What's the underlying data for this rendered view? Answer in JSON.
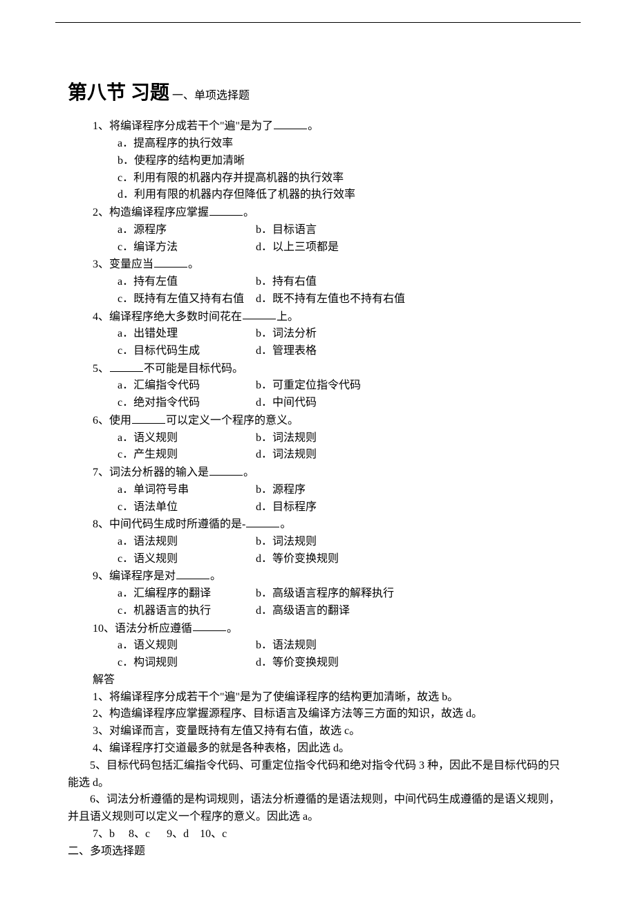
{
  "section_title": "第八节   习题",
  "section_sub": "一、单项选择题",
  "questions": [
    {
      "num": "1",
      "stem_pre": "、将编译程序分成若干个\"遍\"是为了",
      "stem_post": "。",
      "layout": "stack",
      "opts": [
        [
          "a．提高程序的执行效率"
        ],
        [
          "b．使程序的结构更加清晰"
        ],
        [
          "c．利用有限的机器内存并提高机器的执行效率"
        ],
        [
          "d．利用有限的机器内存但降低了机器的执行效率"
        ]
      ]
    },
    {
      "num": "2",
      "stem_pre": "、构造编译程序应掌握",
      "stem_post": "。",
      "layout": "2col",
      "opts": [
        [
          "a．源程序",
          "b．目标语言"
        ],
        [
          "c．编译方法",
          "d．以上三项都是"
        ]
      ]
    },
    {
      "num": "3",
      "stem_pre": "、变量应当",
      "stem_post": "。",
      "layout": "2col",
      "opts": [
        [
          "a．持有左值",
          "b．持有右值"
        ],
        [
          "c．既持有左值又持有右值",
          "d．既不持有左值也不持有右值"
        ]
      ]
    },
    {
      "num": "4",
      "stem_pre": "、编译程序绝大多数时间花在",
      "stem_post": "上。",
      "layout": "2col",
      "opts": [
        [
          "a．出错处理",
          "b．词法分析"
        ],
        [
          "c．目标代码生成",
          "d．管理表格"
        ]
      ]
    },
    {
      "num": "5",
      "stem_pre": "、",
      "stem_post": "不可能是目标代码。",
      "layout": "2col",
      "blank_first": true,
      "opts": [
        [
          "a．汇编指令代码",
          "b．可重定位指令代码"
        ],
        [
          "c．绝对指令代码",
          "d．中间代码"
        ]
      ]
    },
    {
      "num": "6",
      "stem_pre": "、使用",
      "stem_post": "可以定义一个程序的意义。",
      "layout": "2col",
      "opts": [
        [
          "a．语义规则",
          "b．词法规则"
        ],
        [
          "c．产生规则",
          "d．词法规则"
        ]
      ]
    },
    {
      "num": "7",
      "stem_pre": "、词法分析器的输入是",
      "stem_post": "。",
      "layout": "2col",
      "opts": [
        [
          "a．单词符号串",
          "b．源程序"
        ],
        [
          "c．语法单位",
          "d．目标程序"
        ]
      ]
    },
    {
      "num": "8",
      "stem_pre": "、中间代码生成时所遵循的是-",
      "stem_post": "。",
      "layout": "2col",
      "opts": [
        [
          "a．语法规则",
          "b．词法规则"
        ],
        [
          "c．语义规则",
          "d．等价变换规则"
        ]
      ]
    },
    {
      "num": "9",
      "stem_pre": "、编译程序是对",
      "stem_post": "。",
      "layout": "2col",
      "opts": [
        [
          "a．汇编程序的翻译",
          "b．高级语言程序的解释执行"
        ],
        [
          "c．机器语言的执行",
          "d．高级语言的翻译"
        ]
      ]
    },
    {
      "num": "10",
      "stem_pre": "、语法分析应遵循",
      "stem_post": "。",
      "layout": "2col",
      "opts": [
        [
          "a．语义规则",
          "b．语法规则"
        ],
        [
          "c．构词规则",
          "d．等价变换规则"
        ]
      ]
    }
  ],
  "answers_title": "解答",
  "answers": [
    "1、将编译程序分成若干个\"遍\"是为了使编译程序的结构更加清晰，故选 b。",
    "2、构造编译程序应掌握源程序、目标语言及编译方法等三方面的知识，故选 d。",
    "3、对编译而言，变量既持有左值又持有右值，故选 c。",
    "4、编译程序打交道最多的就是各种表格，因此选 d。"
  ],
  "answers_para": [
    "5、目标代码包括汇编指令代码、可重定位指令代码和绝对指令代码 3 种，因此不是目标代码的只能选 d。",
    "6、词法分析遵循的是构词规则，语法分析遵循的是语法规则，中间代码生成遵循的是语义规则，并且语义规则可以定义一个程序的意义。因此选 a。"
  ],
  "answers_short": "7、b     8、c      9、d    10、c",
  "section2": "二、多项选择题"
}
